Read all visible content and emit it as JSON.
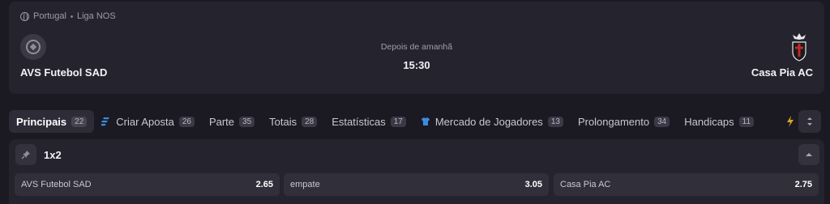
{
  "match": {
    "country": "Portugal",
    "league": "Liga NOS",
    "when": "Depois de amanhã",
    "time": "15:30",
    "home_team": "AVS Futebol SAD",
    "away_team": "Casa Pia AC"
  },
  "tabs": [
    {
      "label": "Principais",
      "count": "22",
      "active": true
    },
    {
      "label": "Criar Aposta",
      "count": "26",
      "icon": "bet-builder-icon"
    },
    {
      "label": "Parte",
      "count": "35"
    },
    {
      "label": "Totais",
      "count": "28"
    },
    {
      "label": "Estatísticas",
      "count": "17"
    },
    {
      "label": "Mercado de Jogadores",
      "count": "13",
      "icon": "jersey-icon"
    },
    {
      "label": "Prolongamento",
      "count": "34"
    },
    {
      "label": "Handicaps",
      "count": "11"
    }
  ],
  "market": {
    "title": "1x2",
    "outcomes": [
      {
        "label": "AVS Futebol SAD",
        "odd": "2.65"
      },
      {
        "label": "empate",
        "odd": "3.05"
      },
      {
        "label": "Casa Pia AC",
        "odd": "2.75"
      }
    ]
  },
  "icons": {
    "breadcrumb": "globe-icon",
    "home_logo": "football-icon",
    "away_logo": "casa-pia-crest-icon",
    "pin": "pin-icon",
    "collapse": "chevron-up-icon",
    "more": "lightning-icon"
  },
  "colors": {
    "background": "#1b1a23",
    "card": "#25242e",
    "accent_blue": "#3a8dde"
  }
}
